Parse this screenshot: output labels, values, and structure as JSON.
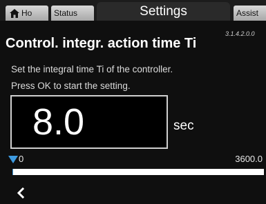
{
  "tabs": {
    "home_label": "Ho",
    "status_label": "Status",
    "active_label": "Settings",
    "assist_label": "Assist"
  },
  "screen_id": "3.1.4.2.0.0",
  "title": "Control. integr. action time Ti",
  "description": [
    "Set the integral time Ti of the controller.",
    "Press OK to start the setting."
  ],
  "setting": {
    "value": "8.0",
    "unit": "sec",
    "min_label": "0",
    "max_label": "3600.0",
    "position_fraction": 0.0022
  },
  "colors": {
    "accent": "#3d9ae0",
    "background": "#0f0f0f"
  },
  "icons": {
    "home": "home-icon",
    "back": "back-arrow-icon"
  }
}
